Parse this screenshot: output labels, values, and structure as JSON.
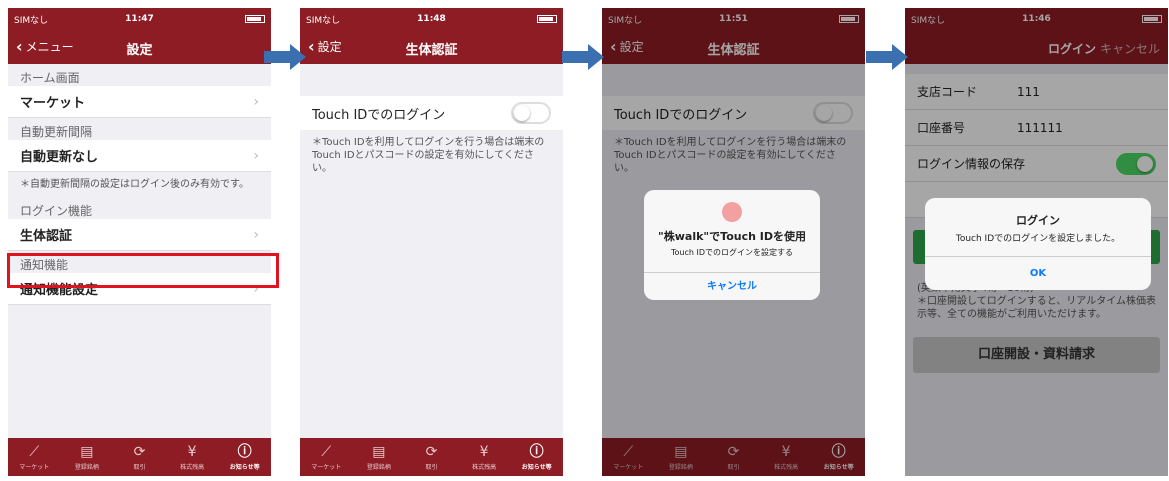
{
  "screen1": {
    "status": {
      "carrier": "SIMなし",
      "time": "11:47"
    },
    "nav": {
      "back": "メニュー",
      "title": "設定"
    },
    "sections": [
      {
        "header": "ホーム画面",
        "item": "マーケット"
      },
      {
        "header": "自動更新間隔",
        "item": "自動更新なし"
      }
    ],
    "note": "＊自動更新間隔の設定はログイン後のみ有効です。",
    "login_header": "ログイン機能",
    "login_item": "生体認証",
    "notify_header": "通知機能",
    "notify_item": "通知機能設定"
  },
  "screen2": {
    "status": {
      "carrier": "SIMなし",
      "time": "11:48"
    },
    "nav": {
      "back": "設定",
      "title": "生体認証"
    },
    "toggle_label": "Touch IDでのログイン",
    "note": "＊Touch IDを利用してログインを行う場合は端末のTouch IDとパスコードの設定を有効にしてください。"
  },
  "screen3": {
    "status": {
      "carrier": "SIMなし",
      "time": "11:51"
    },
    "nav": {
      "back": "設定",
      "title": "生体認証"
    },
    "toggle_label": "Touch IDでのログイン",
    "note": "＊Touch IDを利用してログインを行う場合は端末のTouch IDとパスコードの設定を有効にしてください。",
    "alert": {
      "title": "\"株walk\"でTouch IDを使用",
      "message": "Touch IDでのログインを設定する",
      "button": "キャンセル"
    }
  },
  "screen4": {
    "status": {
      "carrier": "SIMなし",
      "time": "11:46"
    },
    "nav": {
      "title": "ログイン",
      "cancel": "キャンセル"
    },
    "fields": [
      {
        "label": "支店コード",
        "value": "111"
      },
      {
        "label": "口座番号",
        "value": "111111"
      }
    ],
    "save_label": "ログイン情報の保存",
    "alert": {
      "title": "ログイン",
      "message": "Touch IDでのログインを設定しました。",
      "button": "OK"
    },
    "note": "(英数半角文字4桁〜10桁)\n＊口座開設してログインすると、リアルタイム株価表示等、全ての機能がご利用いただけます。",
    "open_account": "口座開設・資料請求"
  },
  "tabs": [
    "マーケット",
    "登録銘柄",
    "取引",
    "株式残高",
    "お知らせ等"
  ],
  "colors": {
    "brand": "#8e1c24",
    "highlight": "#e0141e",
    "switch_on": "#4cd964",
    "arrow": "#3a6fb0"
  }
}
